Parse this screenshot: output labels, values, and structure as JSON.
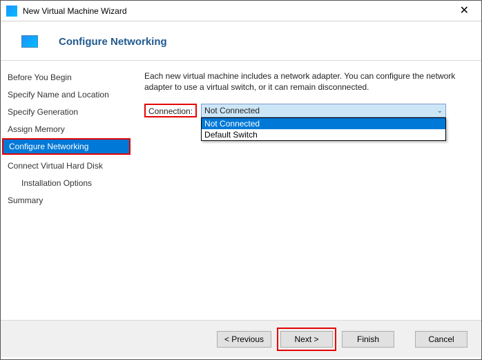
{
  "window": {
    "title": "New Virtual Machine Wizard"
  },
  "page": {
    "heading": "Configure Networking"
  },
  "sidebar": {
    "steps": [
      "Before You Begin",
      "Specify Name and Location",
      "Specify Generation",
      "Assign Memory",
      "Configure Networking",
      "Connect Virtual Hard Disk",
      "Installation Options",
      "Summary"
    ],
    "active_index": 4
  },
  "content": {
    "description": "Each new virtual machine includes a network adapter. You can configure the network adapter to use a virtual switch, or it can remain disconnected.",
    "connection_label": "Connection:",
    "connection_value": "Not Connected",
    "options": [
      "Not Connected",
      "Default Switch"
    ],
    "selected_index": 0
  },
  "footer": {
    "previous": "< Previous",
    "next": "Next >",
    "finish": "Finish",
    "cancel": "Cancel"
  }
}
